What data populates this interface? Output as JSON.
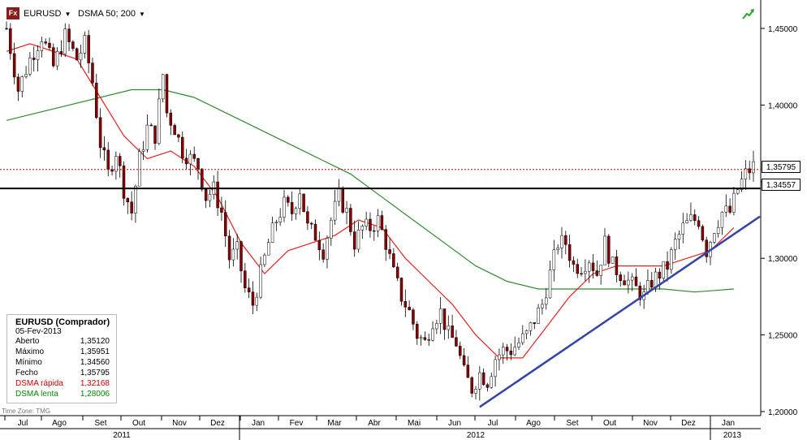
{
  "header": {
    "symbol": "EURUSD",
    "indicator": "DSMA 50; 200",
    "app_icon": "fx-icon",
    "trend_icon": "trend-arrow-icon"
  },
  "legend": {
    "title": "EURUSD (Comprador)",
    "date": "05-Fev-2013",
    "rows": [
      {
        "label": "Aberto",
        "value": "1,35120",
        "color": "#000000"
      },
      {
        "label": "Máximo",
        "value": "1,35951",
        "color": "#000000"
      },
      {
        "label": "Mínimo",
        "value": "1,34560",
        "color": "#000000"
      },
      {
        "label": "Fecho",
        "value": "1,35795",
        "color": "#000000"
      },
      {
        "label": "DSMA rápida",
        "value": "1,32168",
        "color": "#cc0000"
      },
      {
        "label": "DSMA lenta",
        "value": "1,28006",
        "color": "#008800"
      }
    ]
  },
  "timezone": "Time Zone: TMG",
  "price_tags": {
    "current": "1,35795",
    "line": "1,34557"
  },
  "chart_data": {
    "type": "line",
    "ylim": [
      1.195,
      1.465
    ],
    "y_ticks": [
      "1,45000",
      "1,40000",
      "1,35000",
      "1,30000",
      "1,25000",
      "1,20000"
    ],
    "y_tick_values": [
      1.45,
      1.4,
      1.35,
      1.3,
      1.25,
      1.2
    ],
    "x_month_labels": [
      "Jul",
      "Ago",
      "Set",
      "Out",
      "Nov",
      "Dez",
      "Jan",
      "Fev",
      "Mar",
      "Abr",
      "Mai",
      "Jun",
      "Jul",
      "Ago",
      "Set",
      "Out",
      "Nov",
      "Dez",
      "Jan"
    ],
    "x_years": [
      "2011",
      "2012",
      "2013"
    ],
    "colors": {
      "price": "#000000",
      "up_candle": "#ffffff",
      "down_candle": "#8b0000",
      "fast_ma": "#e8221e",
      "slow_ma": "#2e8b2e",
      "trendline": "#3344aa",
      "current_line": "#cc0000",
      "support_line": "#000000"
    },
    "current_price": 1.35795,
    "horizontal_line": 1.34557,
    "price_path": [
      [
        0,
        1.45
      ],
      [
        3,
        1.41
      ],
      [
        6,
        1.43
      ],
      [
        9,
        1.445
      ],
      [
        12,
        1.425
      ],
      [
        15,
        1.445
      ],
      [
        18,
        1.43
      ],
      [
        20,
        1.44
      ],
      [
        22,
        1.415
      ],
      [
        24,
        1.375
      ],
      [
        26,
        1.355
      ],
      [
        28,
        1.37
      ],
      [
        30,
        1.345
      ],
      [
        32,
        1.33
      ],
      [
        34,
        1.365
      ],
      [
        36,
        1.385
      ],
      [
        38,
        1.38
      ],
      [
        40,
        1.42
      ],
      [
        41,
        1.395
      ],
      [
        43,
        1.385
      ],
      [
        45,
        1.37
      ],
      [
        47,
        1.365
      ],
      [
        49,
        1.36
      ],
      [
        51,
        1.34
      ],
      [
        53,
        1.345
      ],
      [
        55,
        1.33
      ],
      [
        57,
        1.3
      ],
      [
        59,
        1.305
      ],
      [
        61,
        1.28
      ],
      [
        63,
        1.27
      ],
      [
        65,
        1.29
      ],
      [
        67,
        1.31
      ],
      [
        69,
        1.325
      ],
      [
        71,
        1.335
      ],
      [
        73,
        1.33
      ],
      [
        75,
        1.345
      ],
      [
        77,
        1.32
      ],
      [
        79,
        1.315
      ],
      [
        81,
        1.305
      ],
      [
        83,
        1.325
      ],
      [
        85,
        1.34
      ],
      [
        87,
        1.33
      ],
      [
        89,
        1.31
      ],
      [
        91,
        1.32
      ],
      [
        93,
        1.32
      ],
      [
        95,
        1.325
      ],
      [
        97,
        1.31
      ],
      [
        99,
        1.29
      ],
      [
        101,
        1.275
      ],
      [
        103,
        1.265
      ],
      [
        105,
        1.25
      ],
      [
        107,
        1.245
      ],
      [
        109,
        1.26
      ],
      [
        111,
        1.265
      ],
      [
        113,
        1.25
      ],
      [
        115,
        1.245
      ],
      [
        117,
        1.225
      ],
      [
        119,
        1.215
      ],
      [
        121,
        1.225
      ],
      [
        123,
        1.22
      ],
      [
        125,
        1.235
      ],
      [
        127,
        1.24
      ],
      [
        129,
        1.24
      ],
      [
        131,
        1.245
      ],
      [
        133,
        1.25
      ],
      [
        135,
        1.26
      ],
      [
        137,
        1.27
      ],
      [
        139,
        1.29
      ],
      [
        141,
        1.31
      ],
      [
        143,
        1.31
      ],
      [
        145,
        1.295
      ],
      [
        147,
        1.295
      ],
      [
        149,
        1.3
      ],
      [
        151,
        1.29
      ],
      [
        153,
        1.31
      ],
      [
        155,
        1.295
      ],
      [
        157,
        1.29
      ],
      [
        159,
        1.285
      ],
      [
        161,
        1.28
      ],
      [
        163,
        1.275
      ],
      [
        165,
        1.285
      ],
      [
        167,
        1.29
      ],
      [
        169,
        1.295
      ],
      [
        171,
        1.31
      ],
      [
        173,
        1.32
      ],
      [
        175,
        1.325
      ],
      [
        177,
        1.325
      ],
      [
        179,
        1.305
      ],
      [
        181,
        1.32
      ],
      [
        183,
        1.33
      ],
      [
        185,
        1.33
      ],
      [
        187,
        1.345
      ],
      [
        189,
        1.355
      ],
      [
        191,
        1.36
      ]
    ],
    "fast_ma": [
      [
        0,
        1.435
      ],
      [
        6,
        1.44
      ],
      [
        12,
        1.435
      ],
      [
        18,
        1.43
      ],
      [
        24,
        1.405
      ],
      [
        30,
        1.38
      ],
      [
        36,
        1.365
      ],
      [
        42,
        1.37
      ],
      [
        48,
        1.36
      ],
      [
        54,
        1.34
      ],
      [
        60,
        1.31
      ],
      [
        66,
        1.29
      ],
      [
        72,
        1.305
      ],
      [
        78,
        1.31
      ],
      [
        84,
        1.315
      ],
      [
        90,
        1.325
      ],
      [
        96,
        1.32
      ],
      [
        102,
        1.3
      ],
      [
        108,
        1.285
      ],
      [
        114,
        1.27
      ],
      [
        120,
        1.25
      ],
      [
        126,
        1.235
      ],
      [
        132,
        1.235
      ],
      [
        138,
        1.255
      ],
      [
        144,
        1.275
      ],
      [
        150,
        1.29
      ],
      [
        156,
        1.295
      ],
      [
        162,
        1.295
      ],
      [
        168,
        1.295
      ],
      [
        174,
        1.3
      ],
      [
        180,
        1.305
      ],
      [
        186,
        1.32
      ]
    ],
    "slow_ma": [
      [
        0,
        1.39
      ],
      [
        8,
        1.395
      ],
      [
        16,
        1.4
      ],
      [
        24,
        1.405
      ],
      [
        32,
        1.41
      ],
      [
        40,
        1.41
      ],
      [
        48,
        1.405
      ],
      [
        56,
        1.395
      ],
      [
        64,
        1.385
      ],
      [
        72,
        1.375
      ],
      [
        80,
        1.365
      ],
      [
        88,
        1.355
      ],
      [
        96,
        1.34
      ],
      [
        104,
        1.325
      ],
      [
        112,
        1.31
      ],
      [
        120,
        1.295
      ],
      [
        128,
        1.285
      ],
      [
        136,
        1.28
      ],
      [
        144,
        1.28
      ],
      [
        152,
        1.28
      ],
      [
        160,
        1.28
      ],
      [
        168,
        1.28
      ],
      [
        176,
        1.278
      ],
      [
        186,
        1.28
      ]
    ],
    "trendline": [
      [
        121,
        1.203
      ],
      [
        191,
        1.322
      ]
    ]
  }
}
